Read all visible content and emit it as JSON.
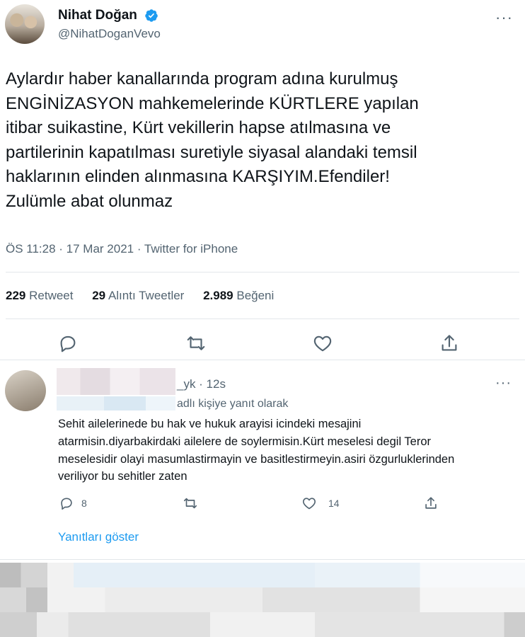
{
  "tweet": {
    "author_name": "Nihat Doğan",
    "author_handle": "@NihatDoganVevo",
    "more": "···",
    "text_lines": [
      "Aylardır haber kanallarında program adına kurulmuş",
      "ENGİNİZASYON mahkemelerinde KÜRTLERE yapılan",
      "itibar suikastine, Kürt vekillerin hapse atılmasına ve",
      "partilerinin kapatılması suretiyle siyasal alandaki temsil",
      "haklarının elinden alınmasına KARŞIYIM.Efendiler!",
      "Zulümle abat olunmaz"
    ],
    "meta": "ÖS 11:28 · 17 Mar 2021 · Twitter for iPhone",
    "stats": {
      "retweets_count": "229",
      "retweets_label": "Retweet",
      "quotes_count": "29",
      "quotes_label": "Alıntı Tweetler",
      "likes_count": "2.989",
      "likes_label": "Beğeni"
    },
    "actions": [
      "reply-icon",
      "retweet-icon",
      "like-icon",
      "share-icon"
    ],
    "accent_color": "#1d9bf0"
  },
  "reply": {
    "handle_suffix": "_yk · 12s",
    "reply_to_suffix": "adlı kişiye yanıt olarak",
    "more": "···",
    "text_lines": [
      "Sehit ailelerinede bu hak ve hukuk arayisi icindeki mesajini",
      "atarmisin.diyarbakirdaki ailelere de soylermisin.Kürt meselesi degil Teror",
      "meselesidir olayi masumlastirmayin ve basitlestirmeyin.asiri özgurluklerinden",
      "veriliyor bu sehitler zaten"
    ],
    "reply_count": "8",
    "like_count": "14",
    "show_replies": "Yanıtları göster"
  }
}
